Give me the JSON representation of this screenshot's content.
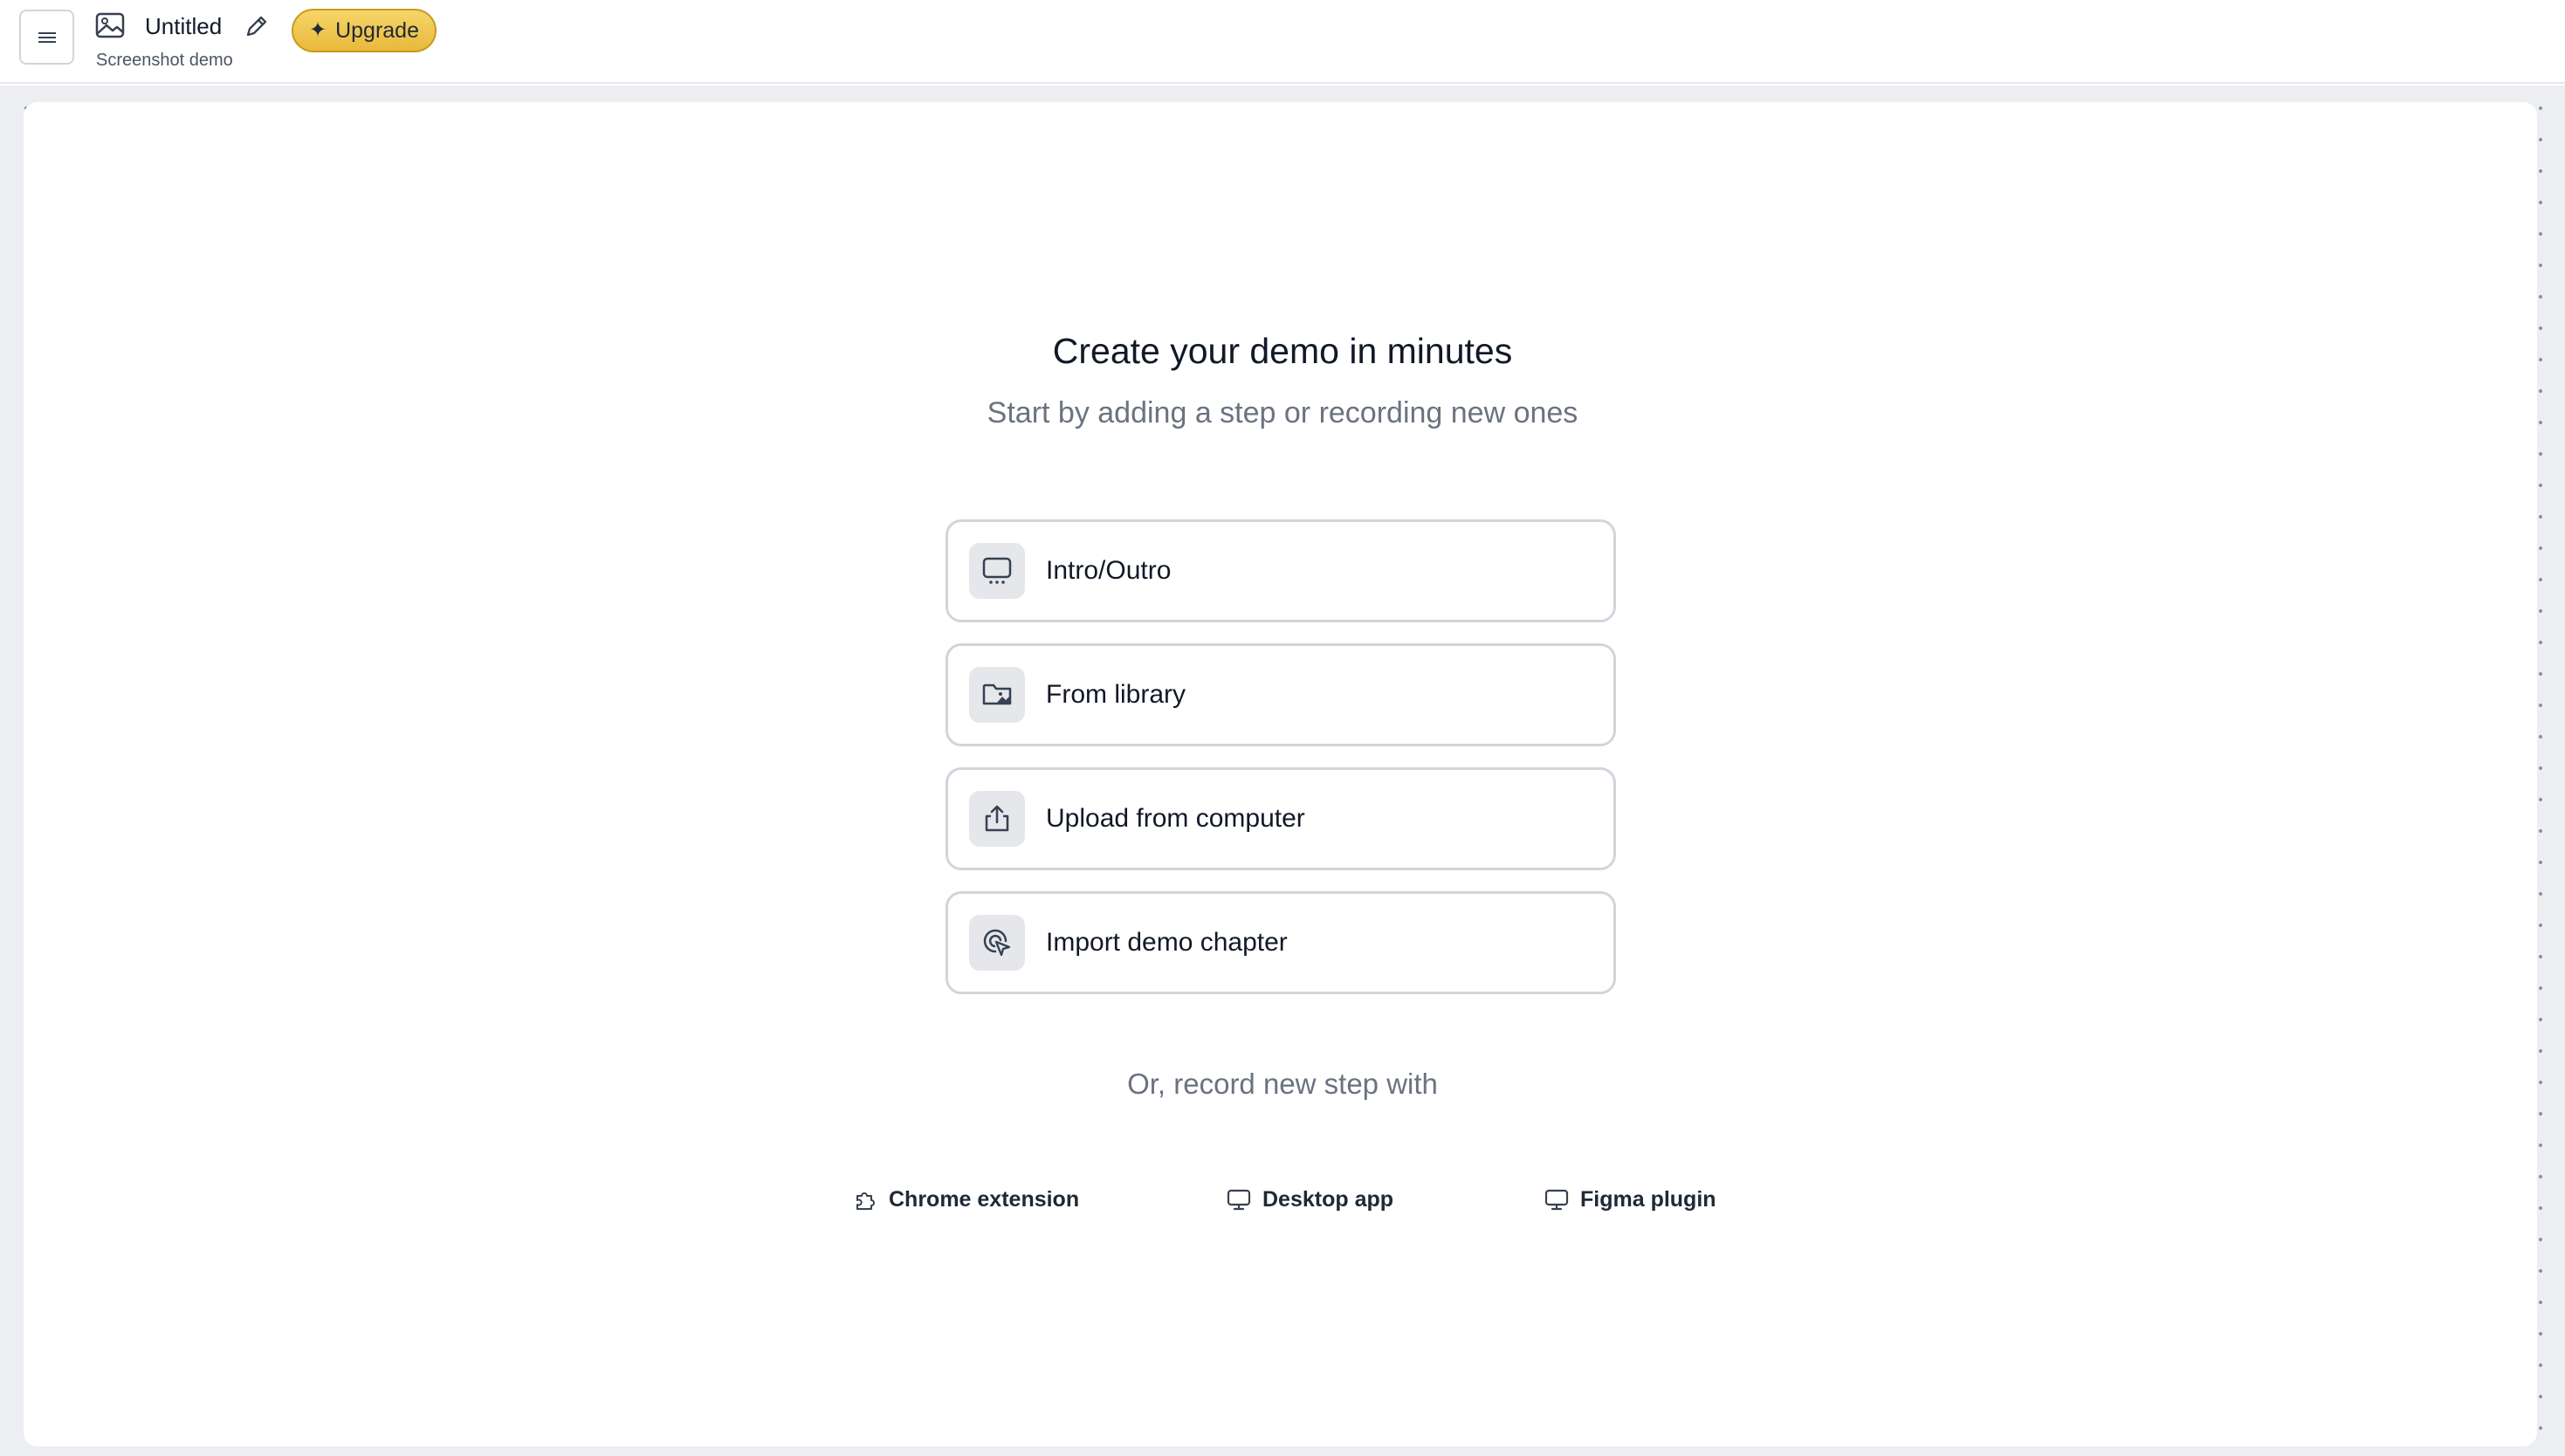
{
  "header": {
    "title": "Untitled",
    "subtitle": "Screenshot demo",
    "upgrade_label": "Upgrade"
  },
  "main": {
    "headline": "Create your demo in minutes",
    "subheadline": "Start by adding a step or recording new ones",
    "options": [
      {
        "label": "Intro/Outro",
        "icon": "presentation-icon"
      },
      {
        "label": "From library",
        "icon": "folder-image-icon"
      },
      {
        "label": "Upload from computer",
        "icon": "upload-icon"
      },
      {
        "label": "Import demo chapter",
        "icon": "pointer-click-icon"
      }
    ],
    "record_prompt": "Or, record new step with",
    "record_options": [
      {
        "label": "Chrome extension",
        "icon": "puzzle-icon"
      },
      {
        "label": "Desktop app",
        "icon": "monitor-icon"
      },
      {
        "label": "Figma plugin",
        "icon": "monitor-icon"
      }
    ]
  },
  "colors": {
    "accent_gold": "#e8b93a",
    "canvas_bg": "#eceef1",
    "text_muted": "#6b7280",
    "border": "#d1d5db"
  }
}
